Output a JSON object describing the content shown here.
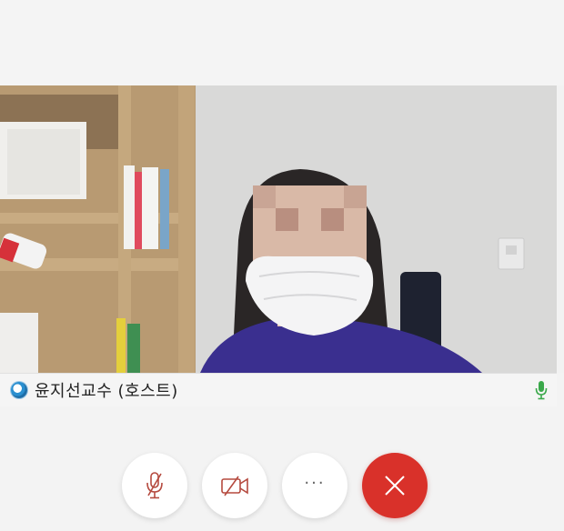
{
  "participant": {
    "name": "윤지선교수 (호스트)",
    "status_icon": "status-dot-icon",
    "mic_icon": "microphone-icon",
    "mic_color": "#3aa84a"
  },
  "controls": [
    {
      "id": "mute",
      "icon": "microphone-muted-icon",
      "color": "#b54a3f"
    },
    {
      "id": "camera",
      "icon": "camera-off-icon",
      "color": "#b54a3f"
    },
    {
      "id": "more",
      "icon": "more-icon",
      "label": "···"
    },
    {
      "id": "leave",
      "icon": "close-icon",
      "color": "#d9312a"
    }
  ],
  "colors": {
    "background": "#f3f3f3",
    "end_call": "#d9312a"
  }
}
